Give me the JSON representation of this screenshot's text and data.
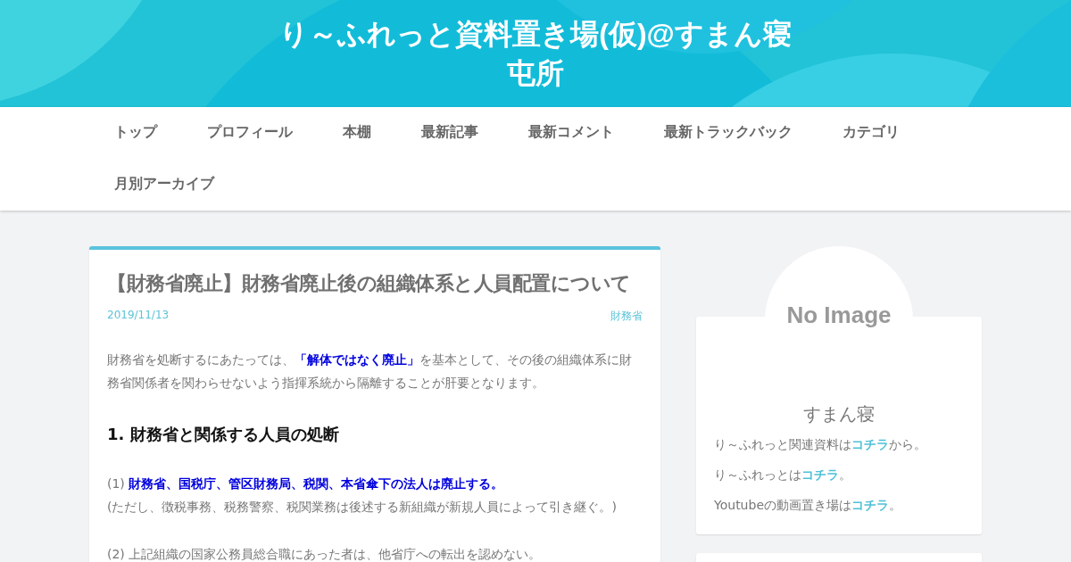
{
  "site": {
    "title": "り～ふれっと資料置き場(仮)@すまん寝屯所"
  },
  "nav": [
    {
      "label": "トップ"
    },
    {
      "label": "プロフィール"
    },
    {
      "label": "本棚"
    },
    {
      "label": "最新記事"
    },
    {
      "label": "最新コメント"
    },
    {
      "label": "最新トラックバック"
    },
    {
      "label": "カテゴリ"
    },
    {
      "label": "月別アーカイブ"
    }
  ],
  "article": {
    "title": "【財務省廃止】財務省廃止後の組織体系と人員配置について",
    "date": "2019/11/13",
    "category": "財務省",
    "body": [
      {
        "kind": "paragraph",
        "lines": [
          [
            {
              "text": "財務省を処断するにあたっては、",
              "strong": false
            },
            {
              "text": "「解体ではなく廃止」",
              "strong": true
            },
            {
              "text": "を基本として、その後の組織体系に財務省関係者を関わらせないよう指揮系統から隔離することが肝要となります。",
              "strong": false
            }
          ]
        ]
      },
      {
        "kind": "heading",
        "text": "1. 財務省と関係する人員の処断"
      },
      {
        "kind": "paragraph",
        "lines": [
          [
            {
              "text": "(1) ",
              "strong": false
            },
            {
              "text": "財務省、国税庁、管区財務局、税関、本省傘下の法人は廃止する。",
              "strong": true
            }
          ],
          [
            {
              "text": "(ただし、徴税事務、税務警察、税関業務は後述する新組織が新規人員によって引き継ぐ。)",
              "strong": false
            }
          ]
        ]
      },
      {
        "kind": "paragraph",
        "lines": [
          [
            {
              "text": "(2) 上記組織の国家公務員総合職にあった者は、他省庁への転出を認めない。",
              "strong": false
            }
          ]
        ]
      }
    ]
  },
  "profile": {
    "avatar": "No Image",
    "name": "すまん寝",
    "lines": [
      [
        {
          "text": "り～ふれっと関連資料は",
          "link": false
        },
        {
          "text": "コチラ",
          "link": true
        },
        {
          "text": "から。",
          "link": false
        }
      ],
      [
        {
          "text": "り～ふれっとは",
          "link": false
        },
        {
          "text": "コチラ",
          "link": true
        },
        {
          "text": "。",
          "link": false
        }
      ],
      [
        {
          "text": "Youtubeの動画置き場は",
          "link": false
        },
        {
          "text": "コチラ",
          "link": true
        },
        {
          "text": "。",
          "link": false
        }
      ]
    ]
  }
}
